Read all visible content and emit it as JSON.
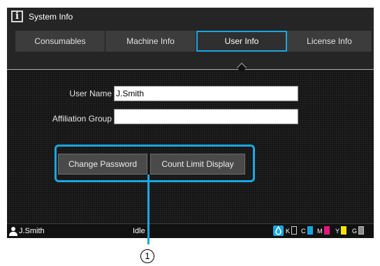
{
  "header": {
    "title": "System Info",
    "icon": "info-icon"
  },
  "tabs": [
    {
      "label": "Consumables",
      "active": false
    },
    {
      "label": "Machine Info",
      "active": false
    },
    {
      "label": "User Info",
      "active": true
    },
    {
      "label": "License Info",
      "active": false
    }
  ],
  "form": {
    "user_name_label": "User Name",
    "user_name_value": "J.Smith",
    "affiliation_label": "Affiliation Group",
    "affiliation_value": ""
  },
  "buttons": {
    "change_password": "Change Password",
    "count_limit": "Count Limit Display"
  },
  "status": {
    "user": "J.Smith",
    "state": "Idle",
    "inks": [
      {
        "label": "K",
        "color": "#1a1a1a"
      },
      {
        "label": "C",
        "color": "#19a3e0"
      },
      {
        "label": "M",
        "color": "#e3177d"
      },
      {
        "label": "Y",
        "color": "#f6e400"
      },
      {
        "label": "G",
        "color": "#8c8c8c"
      }
    ]
  },
  "callout": {
    "number": "1"
  },
  "colors": {
    "accent": "#1aa7e2",
    "background": "#121212"
  }
}
